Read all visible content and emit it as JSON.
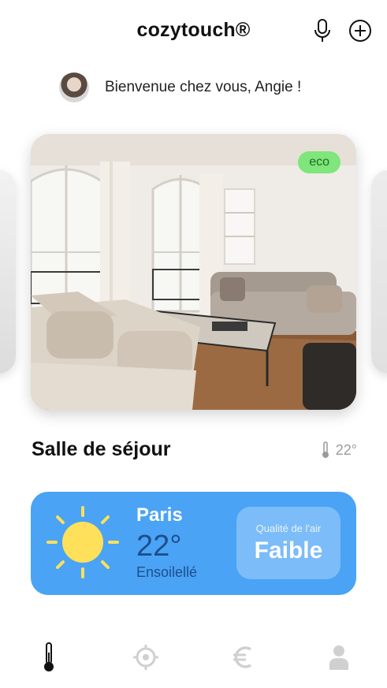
{
  "header": {
    "title": "cozytouch®",
    "mic_icon": "microphone-icon",
    "add_icon": "plus-circle-icon"
  },
  "welcome": {
    "text": "Bienvenue chez vous, Angie !"
  },
  "room": {
    "badge": "eco",
    "name": "Salle de séjour",
    "temperature": "22°"
  },
  "weather": {
    "city": "Paris",
    "temperature": "22°",
    "condition": "Ensoilellé",
    "air_quality_label": "Qualité de l'air",
    "air_quality_value": "Faible",
    "icon": "sun-icon"
  },
  "bottom_nav": {
    "items": [
      {
        "icon": "thermometer-icon",
        "active": true
      },
      {
        "icon": "target-icon",
        "active": false
      },
      {
        "icon": "euro-icon",
        "active": false
      },
      {
        "icon": "user-icon",
        "active": false
      }
    ]
  },
  "colors": {
    "weather_bg": "#4aa3f5",
    "eco_badge": "#7ee67a",
    "weather_dark_text": "#1c4f8c",
    "inactive_icon": "#d0d0d0"
  }
}
